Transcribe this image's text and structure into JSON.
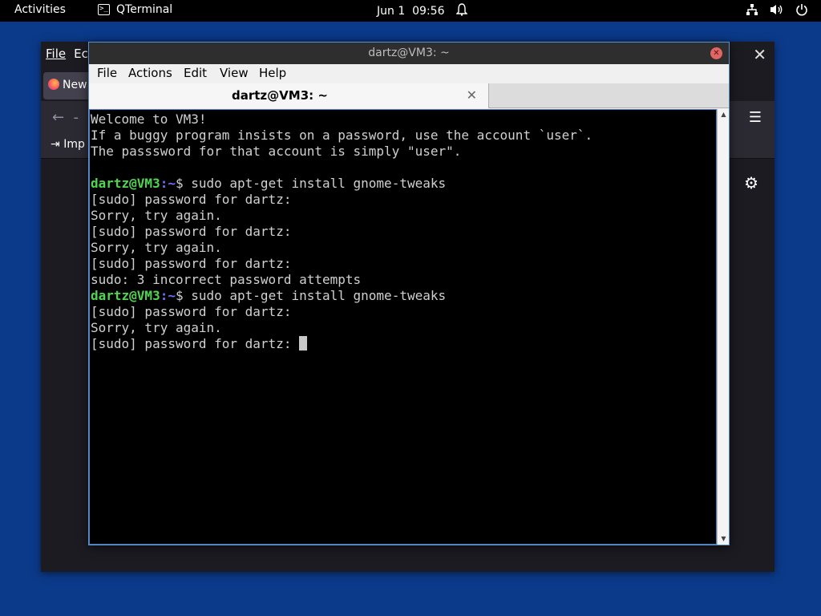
{
  "topbar": {
    "activities": "Activities",
    "app_name": "QTerminal",
    "date": "Jun 1",
    "time": "09:56",
    "icons": [
      "terminal-icon",
      "alarm-bell-icon",
      "network-icon",
      "volume-icon",
      "power-icon"
    ]
  },
  "browser": {
    "menu_file": "File",
    "menu_edit_partial": "Ec",
    "tab_label_partial": "New",
    "import_partial": "Imp"
  },
  "terminal": {
    "window_title": "dartz@VM3: ~",
    "menu": {
      "file": "File",
      "actions": "Actions",
      "edit": "Edit",
      "view": "View",
      "help": "Help"
    },
    "tab_title": "dartz@VM3: ~",
    "prompt_user": "dartz@VM3",
    "prompt_path": ":~",
    "lines": {
      "welcome": "Welcome to VM3!",
      "info1": "If a buggy program insists on a password, use the account `user`.",
      "info2": "The passsword for that account is simply \"user\".",
      "cmd1": "$ sudo apt-get install gnome-tweaks",
      "pw1": "[sudo] password for dartz:",
      "sorry1": "Sorry, try again.",
      "pw2": "[sudo] password for dartz:",
      "sorry2": "Sorry, try again.",
      "pw3": "[sudo] password for dartz:",
      "fail": "sudo: 3 incorrect password attempts",
      "cmd2": "$ sudo apt-get install gnome-tweaks",
      "pw4": "[sudo] password for dartz:",
      "sorry3": "Sorry, try again.",
      "pw5": "[sudo] password for dartz: "
    }
  }
}
